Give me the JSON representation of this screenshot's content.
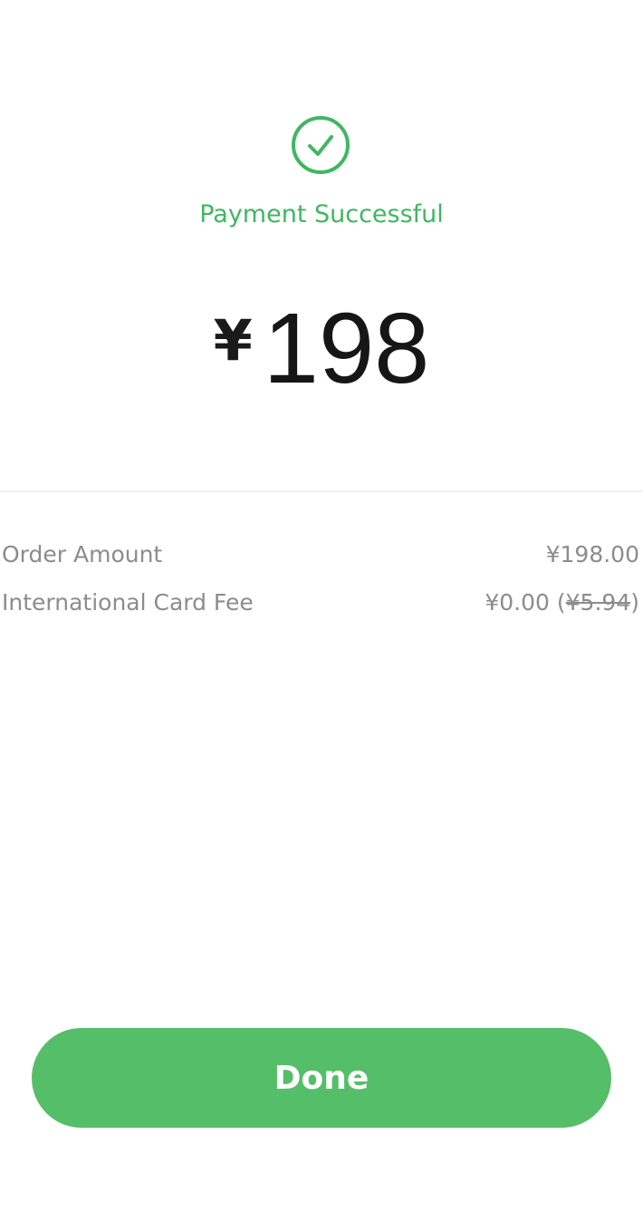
{
  "status": {
    "icon": "checkmark-circle-icon",
    "message": "Payment Successful",
    "color": "#3fb761"
  },
  "amount": {
    "currency": "¥",
    "value": "198"
  },
  "details": {
    "order_amount_label": "Order Amount",
    "order_amount_value": "¥198.00",
    "card_fee_label": "International Card Fee",
    "card_fee_value": "¥0.00",
    "card_fee_open_paren": " (",
    "card_fee_original": "¥5.94",
    "card_fee_close_paren": ")"
  },
  "actions": {
    "done_label": "Done",
    "button_color": "#55be68"
  }
}
